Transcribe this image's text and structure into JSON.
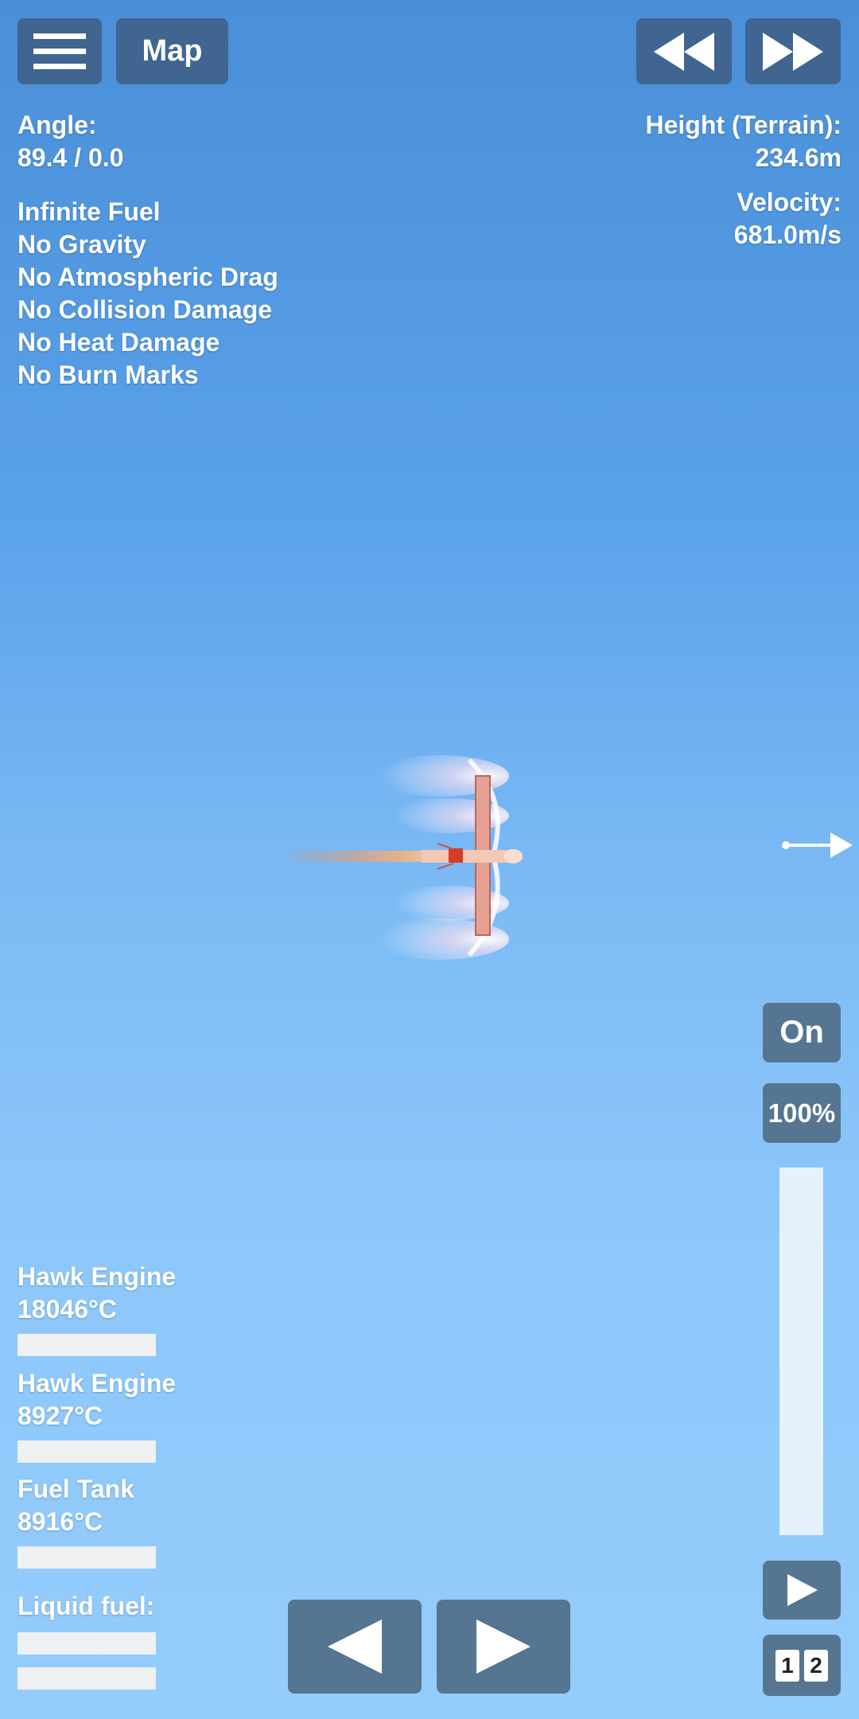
{
  "top": {
    "map_label": "Map",
    "menu_icon": "hamburger-icon",
    "rewind_icon": "rewind-icon",
    "fastforward_icon": "fast-forward-icon"
  },
  "flight": {
    "angle_label": "Angle:",
    "angle_value": "89.4 / 0.0",
    "height_label": "Height (Terrain):",
    "height_value": "234.6m",
    "velocity_label": "Velocity:",
    "velocity_value": "681.0m/s"
  },
  "cheats": [
    "Infinite Fuel",
    "No Gravity",
    "No Atmospheric Drag",
    "No Collision Damage",
    "No Heat Damage",
    "No Burn Marks"
  ],
  "parts": [
    {
      "name": "Hawk Engine",
      "temp": "18046°C"
    },
    {
      "name": "Hawk Engine",
      "temp": "8927°C"
    },
    {
      "name": "Fuel Tank",
      "temp": "8916°C"
    }
  ],
  "fuel": {
    "label": "Liquid fuel:"
  },
  "controls": {
    "engine_state": "On",
    "throttle": "100%",
    "throttle_fraction": 1.0,
    "stage_1": "1",
    "stage_2": "2"
  },
  "colors": {
    "panel": "#3f6590",
    "sky_top": "#4a8fd8",
    "sky_bottom": "#94ccfc"
  }
}
